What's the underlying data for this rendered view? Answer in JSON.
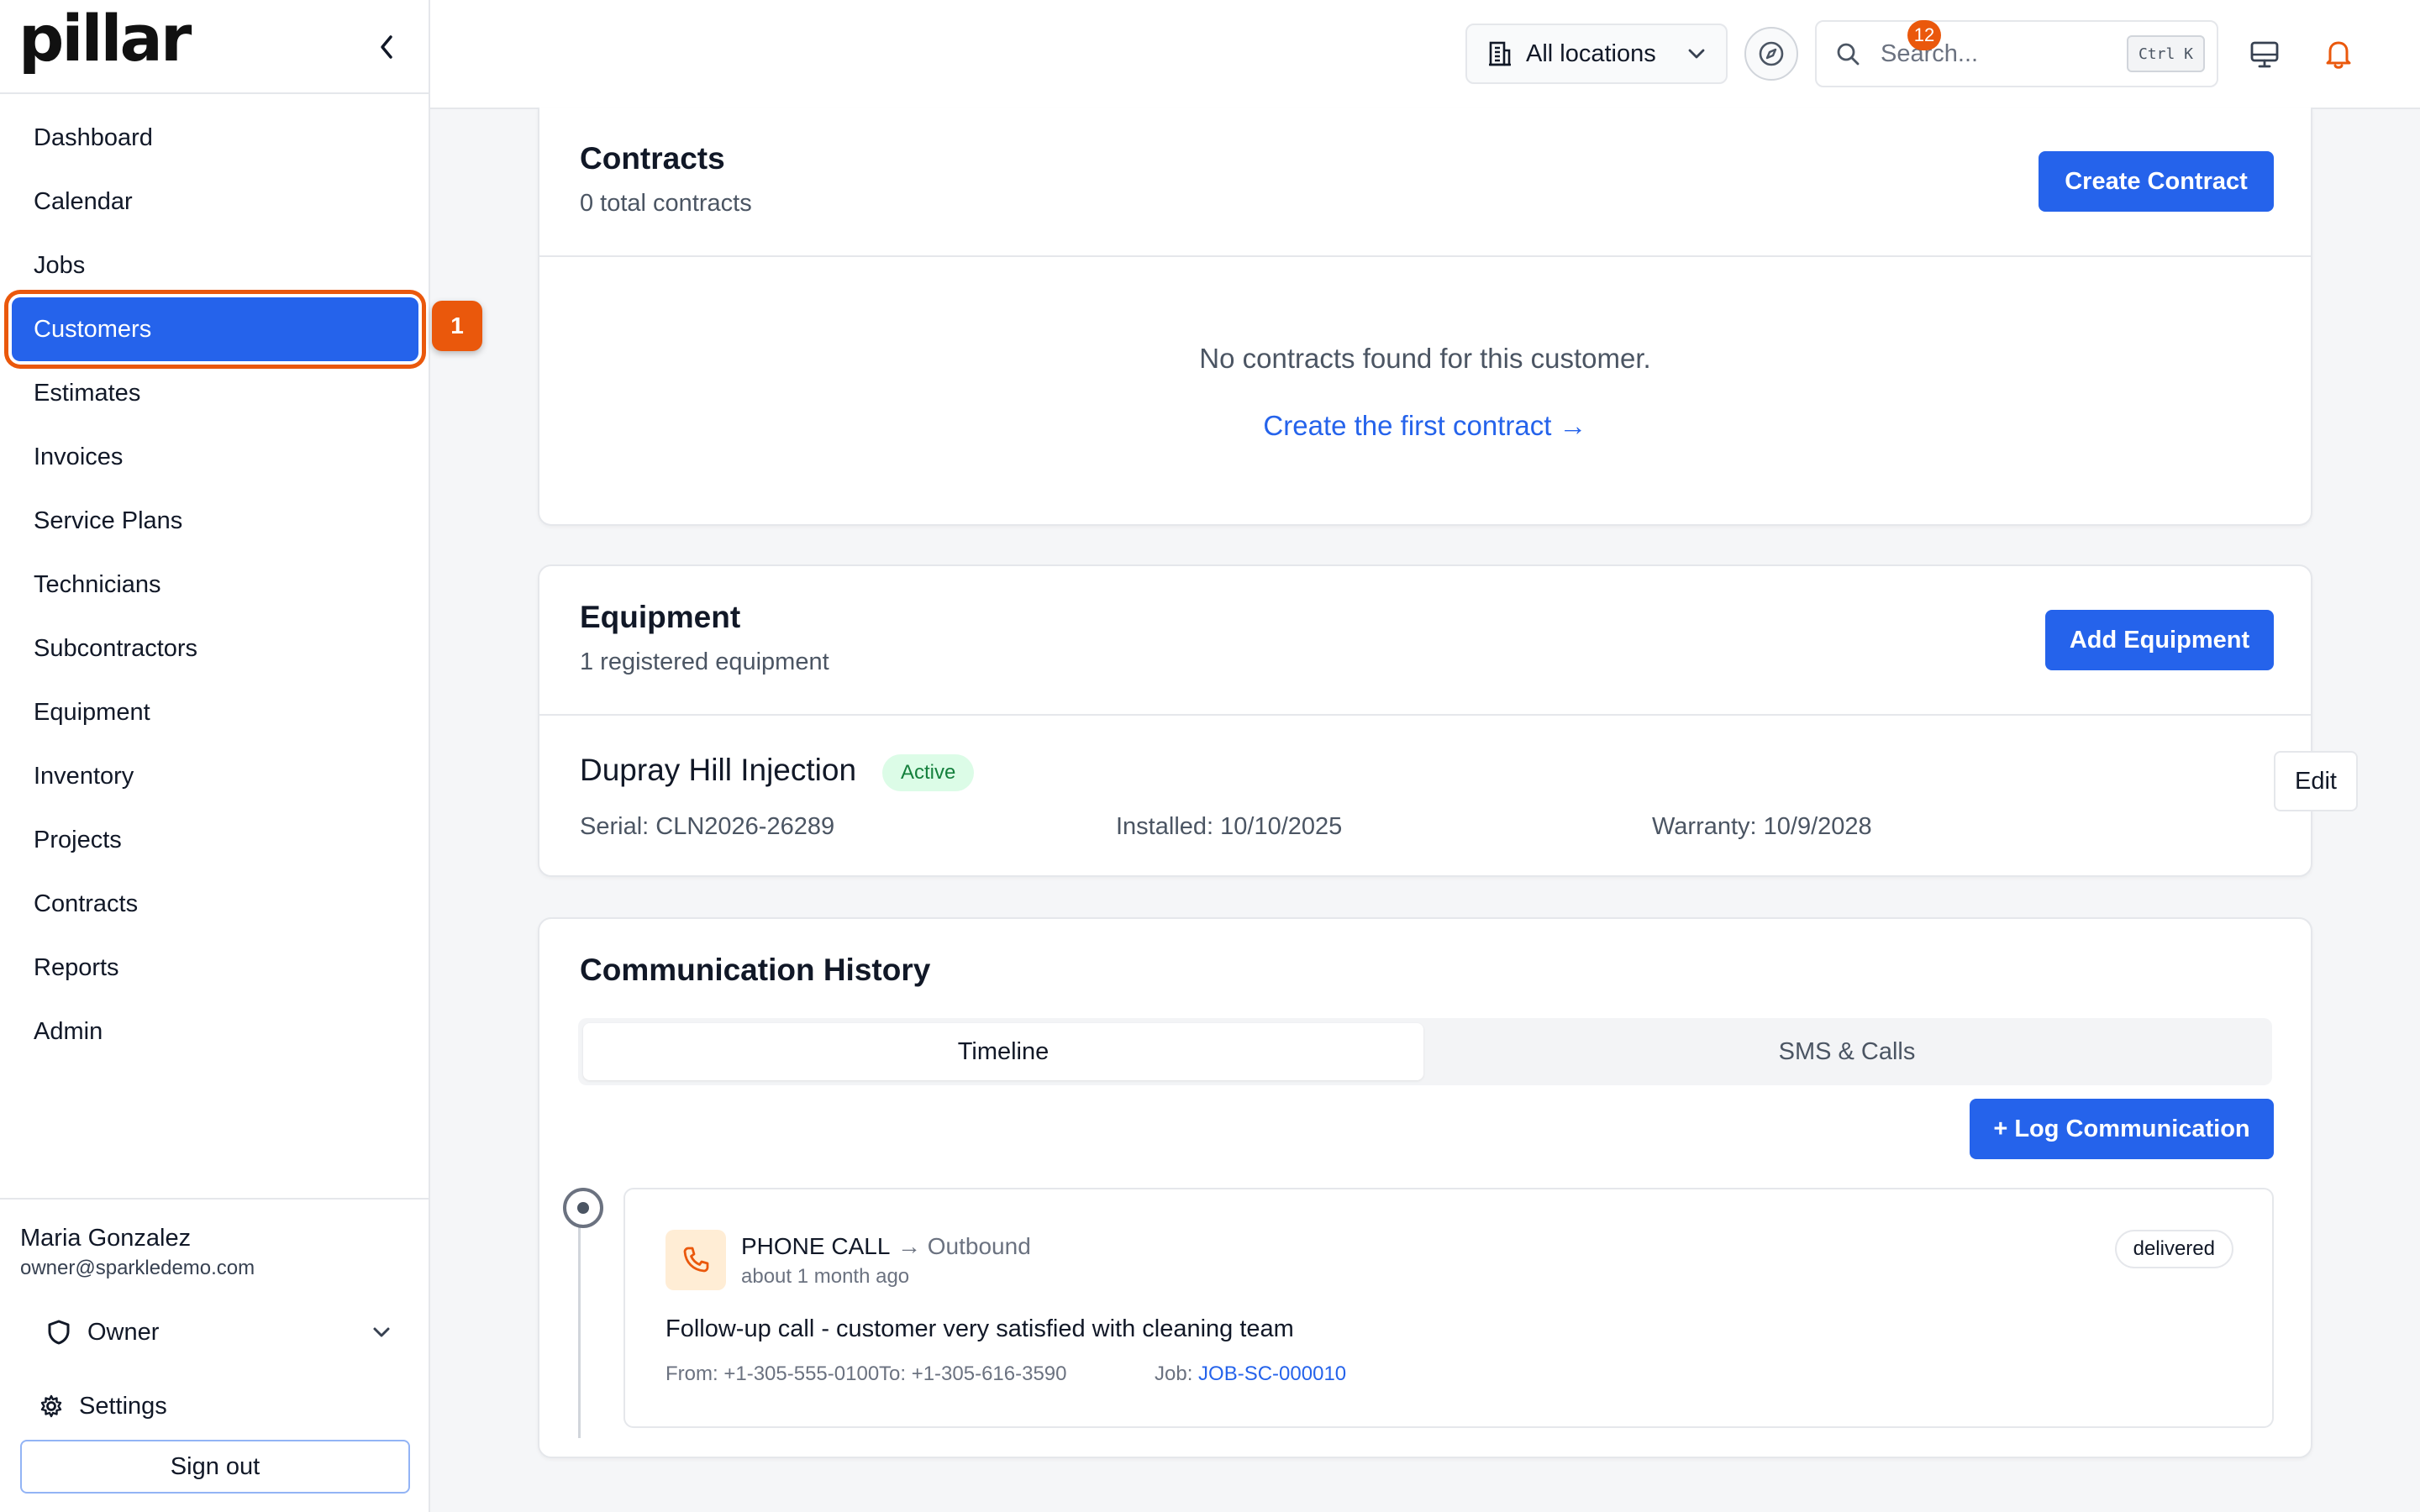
{
  "brand": {
    "logo_text": "pillar",
    "accent": "#2563eb",
    "highlight": "#ea580c"
  },
  "sidebar": {
    "collapse_icon": "chevron-left-icon",
    "items": [
      {
        "label": "Dashboard",
        "active": false
      },
      {
        "label": "Calendar",
        "active": false
      },
      {
        "label": "Jobs",
        "active": false
      },
      {
        "label": "Customers",
        "active": true
      },
      {
        "label": "Estimates",
        "active": false
      },
      {
        "label": "Invoices",
        "active": false
      },
      {
        "label": "Service Plans",
        "active": false
      },
      {
        "label": "Technicians",
        "active": false
      },
      {
        "label": "Subcontractors",
        "active": false
      },
      {
        "label": "Equipment",
        "active": false
      },
      {
        "label": "Inventory",
        "active": false
      },
      {
        "label": "Projects",
        "active": false
      },
      {
        "label": "Contracts",
        "active": false
      },
      {
        "label": "Reports",
        "active": false
      },
      {
        "label": "Admin",
        "active": false
      }
    ],
    "step_badge": "1",
    "user": {
      "name": "Maria Gonzalez",
      "email": "owner@sparkledemo.com",
      "role": "Owner",
      "settings_label": "Settings",
      "signout_label": "Sign out"
    }
  },
  "topbar": {
    "location_label": "All locations",
    "search_placeholder": "Search...",
    "search_shortcut": "Ctrl K",
    "notification_count": "12"
  },
  "contracts": {
    "title": "Contracts",
    "subtitle": "0 total contracts",
    "create_button": "Create Contract",
    "empty_message": "No contracts found for this customer.",
    "empty_link": "Create the first contract →"
  },
  "equipment": {
    "title": "Equipment",
    "subtitle": "1 registered equipment",
    "add_button": "Add Equipment",
    "item": {
      "name": "Dupray Hill Injection",
      "status": "Active",
      "serial_label": "Serial:",
      "serial": "CLN2026-26289",
      "installed_label": "Installed:",
      "installed": "10/10/2025",
      "warranty_label": "Warranty:",
      "warranty": "10/9/2028",
      "edit_label": "Edit"
    }
  },
  "communication": {
    "title": "Communication History",
    "tabs": [
      "Timeline",
      "SMS & Calls"
    ],
    "active_tab": "Timeline",
    "log_button": "+ Log Communication",
    "entry": {
      "type": "PHONE CALL",
      "direction": "→ Outbound",
      "time": "about 1 month ago",
      "status": "delivered",
      "body": "Follow-up call - customer very satisfied with cleaning team",
      "from_label": "From:",
      "from": "+1-305-555-0100",
      "to_label": "To:",
      "to": "+1-305-616-3590",
      "job_label": "Job:",
      "job": "JOB-SC-000010"
    }
  }
}
